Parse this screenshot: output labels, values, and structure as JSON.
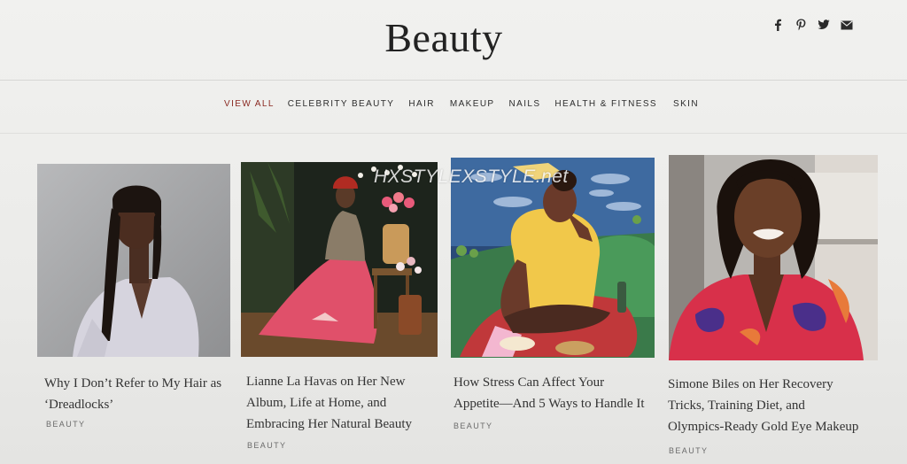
{
  "site": {
    "title": "Beauty",
    "social": [
      {
        "icon": "facebook-icon",
        "glyph": "f"
      },
      {
        "icon": "pinterest-icon",
        "glyph": "P"
      },
      {
        "icon": "twitter-icon",
        "glyph": "t"
      },
      {
        "icon": "email-icon",
        "glyph": "✉"
      }
    ]
  },
  "nav": {
    "items": [
      {
        "label": "View All",
        "active": true
      },
      {
        "label": "Celebrity Beauty",
        "active": false
      },
      {
        "label": "Hair",
        "active": false
      },
      {
        "label": "Makeup",
        "active": false
      },
      {
        "label": "Nails",
        "active": false
      },
      {
        "label": "Health & Fitness",
        "active": false
      },
      {
        "label": "Skin",
        "active": false
      }
    ],
    "active_color": "#8a2a22"
  },
  "articles": [
    {
      "headline_lines": [
        "Why I Don’t Refer to My Hair as",
        "‘Dreadlocks’"
      ],
      "category": "Beauty"
    },
    {
      "headline_lines": [
        "Lianne La Havas on Her New",
        "Album, Life at Home, and",
        "Embracing Her Natural Beauty"
      ],
      "category": "Beauty"
    },
    {
      "headline_lines": [
        "How Stress Can Affect Your",
        "Appetite—And 5 Ways to Handle It"
      ],
      "category": "Beauty"
    },
    {
      "headline_lines": [
        "Simone Biles on Her Recovery",
        "Tricks, Training Diet, and",
        "Olympics-Ready Gold Eye Makeup"
      ],
      "category": "Beauty"
    }
  ],
  "watermark": "HXSTYLEXSTYLE.net"
}
